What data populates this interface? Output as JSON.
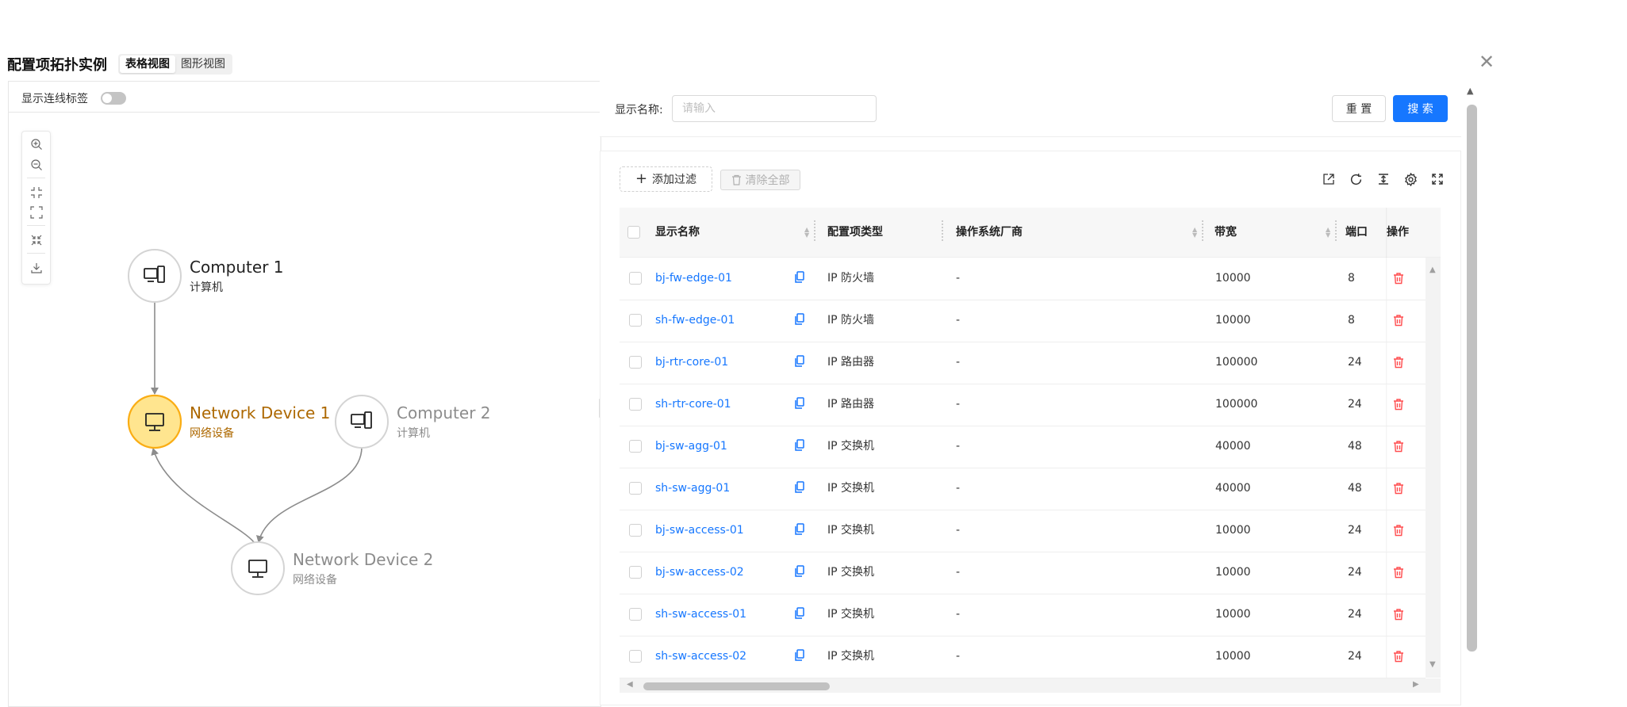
{
  "dialog": {
    "title": "配置项拓扑实例",
    "tabs": [
      {
        "label": "表格视图",
        "active": true
      },
      {
        "label": "图形视图",
        "active": false
      }
    ],
    "close_glyph": "✕"
  },
  "graph_panel": {
    "toggle_label": "显示连线标签",
    "toggle_on": false,
    "nodes": [
      {
        "name": "Computer 1",
        "type": "计算机",
        "icon": "computer-icon",
        "highlighted": false
      },
      {
        "name": "Network Device 1",
        "type": "网络设备",
        "icon": "monitor-icon",
        "highlighted": true
      },
      {
        "name": "Computer 2",
        "type": "计算机",
        "icon": "computer-icon",
        "highlighted": false
      },
      {
        "name": "Network Device 2",
        "type": "网络设备",
        "icon": "monitor-icon",
        "highlighted": false
      }
    ],
    "zoom_tools": [
      "zoom-in-icon",
      "zoom-out-icon",
      "fit-icon",
      "fullscreen-icon",
      "collapse-icon",
      "download-icon"
    ]
  },
  "search": {
    "label": "显示名称:",
    "placeholder": "请输入",
    "value": "",
    "reset_label": "重 置",
    "search_label": "搜 索"
  },
  "toolbar": {
    "add_filter_label": "添加过滤",
    "clear_all_label": "清除全部",
    "icons": [
      "export-icon",
      "refresh-icon",
      "column-height-icon",
      "settings-icon",
      "fullscreen-icon"
    ]
  },
  "table": {
    "columns": {
      "name": "显示名称",
      "ci_type": "配置项类型",
      "os_vendor": "操作系统厂商",
      "bandwidth": "带宽",
      "port": "端口",
      "action": "操作"
    },
    "rows": [
      {
        "name": "bj-fw-edge-01",
        "ci_type": "IP 防火墙",
        "os_vendor": "-",
        "bandwidth": "10000",
        "port": "8"
      },
      {
        "name": "sh-fw-edge-01",
        "ci_type": "IP 防火墙",
        "os_vendor": "-",
        "bandwidth": "10000",
        "port": "8"
      },
      {
        "name": "bj-rtr-core-01",
        "ci_type": "IP 路由器",
        "os_vendor": "-",
        "bandwidth": "100000",
        "port": "24"
      },
      {
        "name": "sh-rtr-core-01",
        "ci_type": "IP 路由器",
        "os_vendor": "-",
        "bandwidth": "100000",
        "port": "24"
      },
      {
        "name": "bj-sw-agg-01",
        "ci_type": "IP 交换机",
        "os_vendor": "-",
        "bandwidth": "40000",
        "port": "48"
      },
      {
        "name": "sh-sw-agg-01",
        "ci_type": "IP 交换机",
        "os_vendor": "-",
        "bandwidth": "40000",
        "port": "48"
      },
      {
        "name": "bj-sw-access-01",
        "ci_type": "IP 交换机",
        "os_vendor": "-",
        "bandwidth": "10000",
        "port": "24"
      },
      {
        "name": "bj-sw-access-02",
        "ci_type": "IP 交换机",
        "os_vendor": "-",
        "bandwidth": "10000",
        "port": "24"
      },
      {
        "name": "sh-sw-access-01",
        "ci_type": "IP 交换机",
        "os_vendor": "-",
        "bandwidth": "10000",
        "port": "24"
      },
      {
        "name": "sh-sw-access-02",
        "ci_type": "IP 交换机",
        "os_vendor": "-",
        "bandwidth": "10000",
        "port": "24"
      }
    ]
  },
  "colors": {
    "primary": "#1677ff",
    "danger": "#ff4d4f",
    "highlight_fill": "#ffe58f",
    "highlight_stroke": "#faad14",
    "highlight_text": "#ad6800"
  }
}
